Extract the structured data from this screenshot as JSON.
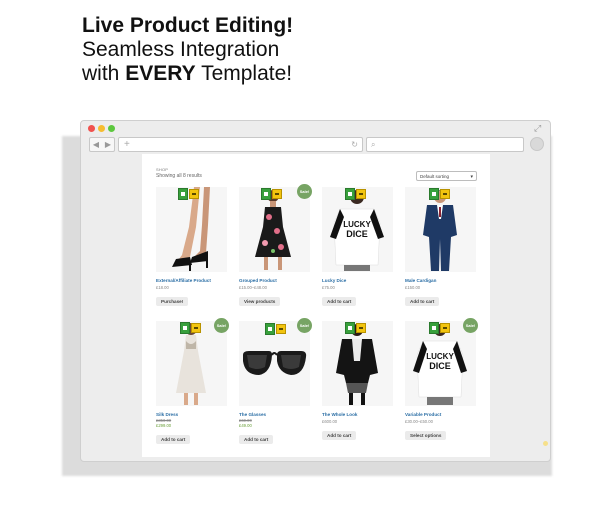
{
  "headline": {
    "line1": "Live Product Editing!",
    "line2": "Seamless Integration",
    "line3_prefix": "with ",
    "line3_bold": "EVERY",
    "line3_suffix": " Template!"
  },
  "browser": {
    "nav_back": "◀",
    "nav_forward": "▶",
    "url_plus": "+",
    "reload_icon": "↻",
    "search_icon": "⌕"
  },
  "shop": {
    "breadcrumb": "SHOP",
    "results": "Showing all 8 results",
    "sorting": "Default sorting"
  },
  "products": [
    {
      "name": "External/Affiliate Product",
      "price": "£18.00",
      "old": "",
      "button": "Purchase!",
      "sale": false,
      "photo": "legs-heels"
    },
    {
      "name": "Grouped Product",
      "price": "£15.00–£48.00",
      "old": "",
      "button": "View products",
      "sale": true,
      "photo": "floral-dress"
    },
    {
      "name": "Lucky Dice",
      "price": "£75.00",
      "old": "",
      "button": "Add to cart",
      "sale": false,
      "photo": "lucky-shirt"
    },
    {
      "name": "Male Cardigan",
      "price": "£150.00",
      "old": "",
      "button": "Add to cart",
      "sale": false,
      "photo": "suit"
    },
    {
      "name": "Silk Dress",
      "price": "£299.00",
      "old": "£350.00",
      "button": "Add to cart",
      "sale": true,
      "photo": "silk-dress"
    },
    {
      "name": "The Glasses",
      "price": "£49.00",
      "old": "£60.00",
      "button": "Add to cart",
      "sale": true,
      "photo": "glasses"
    },
    {
      "name": "The Whole Look",
      "price": "£600.00",
      "old": "",
      "button": "Add to cart",
      "sale": false,
      "photo": "leather-jacket"
    },
    {
      "name": "Variable Product",
      "price": "£30.00–£50.00",
      "old": "",
      "button": "Select options",
      "sale": true,
      "photo": "lucky-shirt-2"
    }
  ],
  "sale_label": "Sale!",
  "colors": {
    "sale_badge": "#77a464",
    "link": "#2b6ea5",
    "edit_green": "#38a03c",
    "edit_yellow": "#f2c40f"
  }
}
